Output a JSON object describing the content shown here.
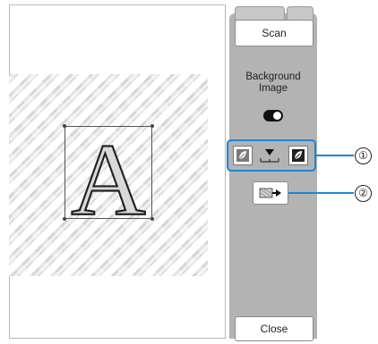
{
  "panel": {
    "scan_label": "Scan",
    "background_image_label": "Background\nImage",
    "toggle_on": true,
    "close_label": "Close"
  },
  "canvas": {
    "letter": "A"
  },
  "callouts": {
    "one": "①",
    "two": "②"
  },
  "colors": {
    "accent": "#1b86d6",
    "panel_bg": "#b3b3b3"
  },
  "icons": {
    "light_leaf": "leaf-light-icon",
    "dark_leaf": "leaf-dark-icon",
    "slider_marker": "triangle-marker-icon",
    "send": "pattern-send-icon"
  }
}
